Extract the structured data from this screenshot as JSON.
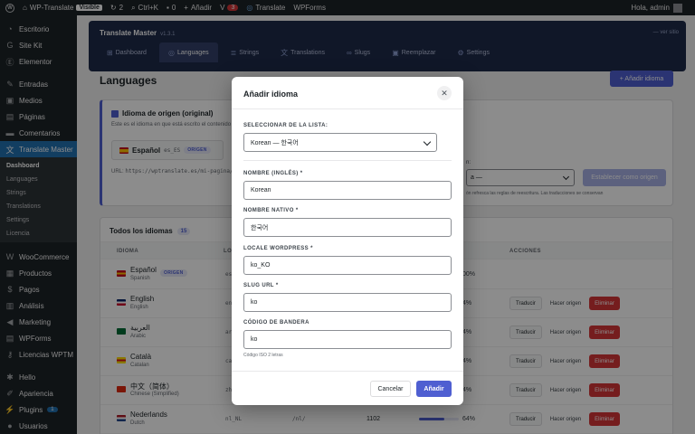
{
  "adminbar": {
    "site": "WP-Translate",
    "visible_badge": "Visible",
    "updates": "2",
    "shortcut": "Ctrl+K",
    "comments": "0",
    "new": "Añadir",
    "notify_count": "3",
    "translate": "Translate",
    "wpforms": "WPForms",
    "greeting": "Hola, admin"
  },
  "sidebar": {
    "items": [
      {
        "label": "Escritorio",
        "icon": "dashboard-icon"
      },
      {
        "label": "Site Kit",
        "icon": "g-icon"
      },
      {
        "label": "Elementor",
        "icon": "elementor-icon"
      },
      {
        "label": "Entradas",
        "icon": "pin-icon"
      },
      {
        "label": "Medios",
        "icon": "media-icon"
      },
      {
        "label": "Páginas",
        "icon": "page-icon"
      },
      {
        "label": "Comentarios",
        "icon": "comment-icon"
      },
      {
        "label": "Translate Master",
        "icon": "translate-icon"
      }
    ],
    "submenu": [
      "Dashboard",
      "Languages",
      "Strings",
      "Translations",
      "Settings",
      "Licencia"
    ],
    "items2": [
      {
        "label": "WooCommerce",
        "icon": "woo-icon"
      },
      {
        "label": "Productos",
        "icon": "box-icon"
      },
      {
        "label": "Pagos",
        "icon": "dollar-icon"
      },
      {
        "label": "Análisis",
        "icon": "chart-icon"
      },
      {
        "label": "Marketing",
        "icon": "megaphone-icon"
      },
      {
        "label": "WPForms",
        "icon": "form-icon"
      },
      {
        "label": "Licencias WPTM",
        "icon": "key-icon"
      }
    ],
    "items3": [
      {
        "label": "Hello",
        "icon": "hello-icon"
      },
      {
        "label": "Apariencia",
        "icon": "brush-icon"
      },
      {
        "label": "Plugins",
        "icon": "plug-icon",
        "count": "1"
      },
      {
        "label": "Usuarios",
        "icon": "user-icon"
      }
    ]
  },
  "plugin": {
    "title": "Translate Master",
    "version": "v1.3.1",
    "link": "— ver sitio",
    "tabs": [
      "Dashboard",
      "Languages",
      "Strings",
      "Translations",
      "Slugs",
      "Reemplazar",
      "Settings"
    ]
  },
  "page": {
    "title": "Languages",
    "add_button": "+ Añadir idioma"
  },
  "origin": {
    "title": "Idioma de origen (original)",
    "desc": "Este es el idioma en que está escrito el contenido",
    "lang": "Español",
    "code": "es_ES",
    "tag": "ORIGEN",
    "url_label": "URL:",
    "url": "https://wptranslate.es/mi-pagina/",
    "select_label": "n:",
    "select_value": "a —",
    "set_button": "Establecer como origen",
    "hint": "ón refresca las reglas de reescritura. Las traducciones se conservan"
  },
  "languages": {
    "title": "Todos los idiomas",
    "count": "15",
    "headers": {
      "lang": "IDIOMA",
      "locale": "LO",
      "actions": "ACCIONES"
    },
    "actions": {
      "translate": "Traducir",
      "set_origin": "Hacer origen",
      "delete": "Eliminar"
    },
    "rows": [
      {
        "name": "Español",
        "native": "Spanish",
        "code": "es",
        "origin": true,
        "pct_label": "00%",
        "pct": 1.0,
        "flag": [
          "#c60b1e",
          "#ffc400",
          "#c60b1e"
        ]
      },
      {
        "name": "English",
        "native": "English",
        "code": "en",
        "pct_label": "4%",
        "pct": 0.64,
        "flag": [
          "#012169",
          "#ffffff",
          "#c8102e"
        ]
      },
      {
        "name": "العربية",
        "native": "Arabic",
        "code": "ar",
        "pct_label": "4%",
        "pct": 0.64,
        "flag": [
          "#006c35",
          "#006c35",
          "#006c35"
        ]
      },
      {
        "name": "Català",
        "native": "Catalan",
        "code": "ca",
        "pct_label": "4%",
        "pct": 0.64,
        "flag": [
          "#fcdd09",
          "#da121a",
          "#fcdd09"
        ]
      },
      {
        "name": "中文（简体）",
        "native": "Chinese (Simplified)",
        "code": "zh",
        "pct_label": "4%",
        "pct": 0.64,
        "flag": [
          "#de2910",
          "#de2910",
          "#de2910"
        ]
      },
      {
        "name": "Nederlands",
        "native": "Dutch",
        "code": "nl_NL",
        "slug": "/nl/",
        "strings": "1102",
        "pct_label": "64%",
        "pct": 0.64,
        "flag": [
          "#ae1c28",
          "#ffffff",
          "#21468b"
        ]
      }
    ]
  },
  "modal": {
    "title": "Añadir idioma",
    "select_label": "SELECCIONAR DE LA LISTA:",
    "select_value": "Korean — 한국어",
    "name_label": "NOMBRE (INGLÉS) *",
    "name_value": "Korean",
    "native_label": "NOMBRE NATIVO *",
    "native_value": "한국어",
    "locale_label": "LOCALE WORDPRESS *",
    "locale_value": "ko_KO",
    "slug_label": "SLUG URL *",
    "slug_value": "ko",
    "flag_label": "CÓDIGO DE BANDERA",
    "flag_value": "ko",
    "flag_hint": "Código ISO 2 letras",
    "cancel": "Cancelar",
    "submit": "Añadir"
  }
}
